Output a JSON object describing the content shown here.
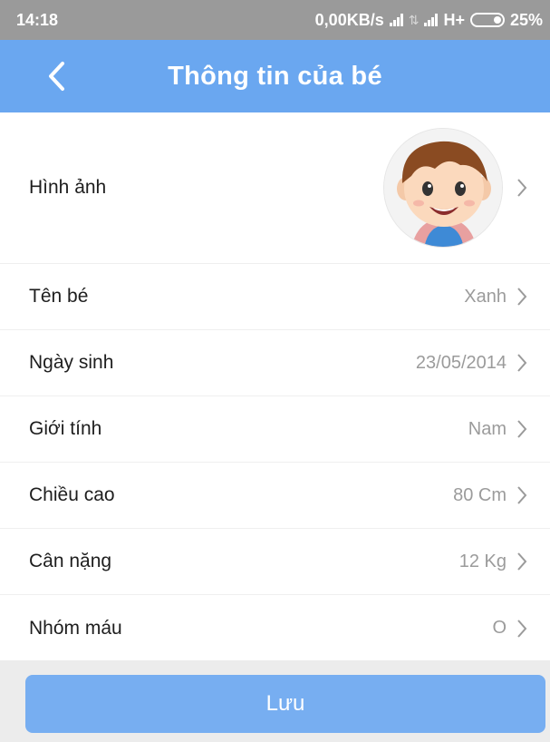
{
  "status_bar": {
    "time": "14:18",
    "speed": "0,00KB/s",
    "network": "H+",
    "battery": "25%"
  },
  "header": {
    "title": "Thông tin của bé",
    "back_icon": "chevron-left-icon"
  },
  "rows": [
    {
      "label": "Hình ảnh",
      "value": ""
    },
    {
      "label": "Tên bé",
      "value": "Xanh"
    },
    {
      "label": "Ngày sinh",
      "value": "23/05/2014"
    },
    {
      "label": "Giới tính",
      "value": "Nam"
    },
    {
      "label": "Chiều cao",
      "value": "80 Cm"
    },
    {
      "label": "Cân nặng",
      "value": "12 Kg"
    },
    {
      "label": "Nhóm máu",
      "value": "O"
    }
  ],
  "save_label": "Lưu",
  "colors": {
    "header": "#6aa7f0",
    "save_button": "#77aef1",
    "status_bar": "#9a9a9a"
  }
}
